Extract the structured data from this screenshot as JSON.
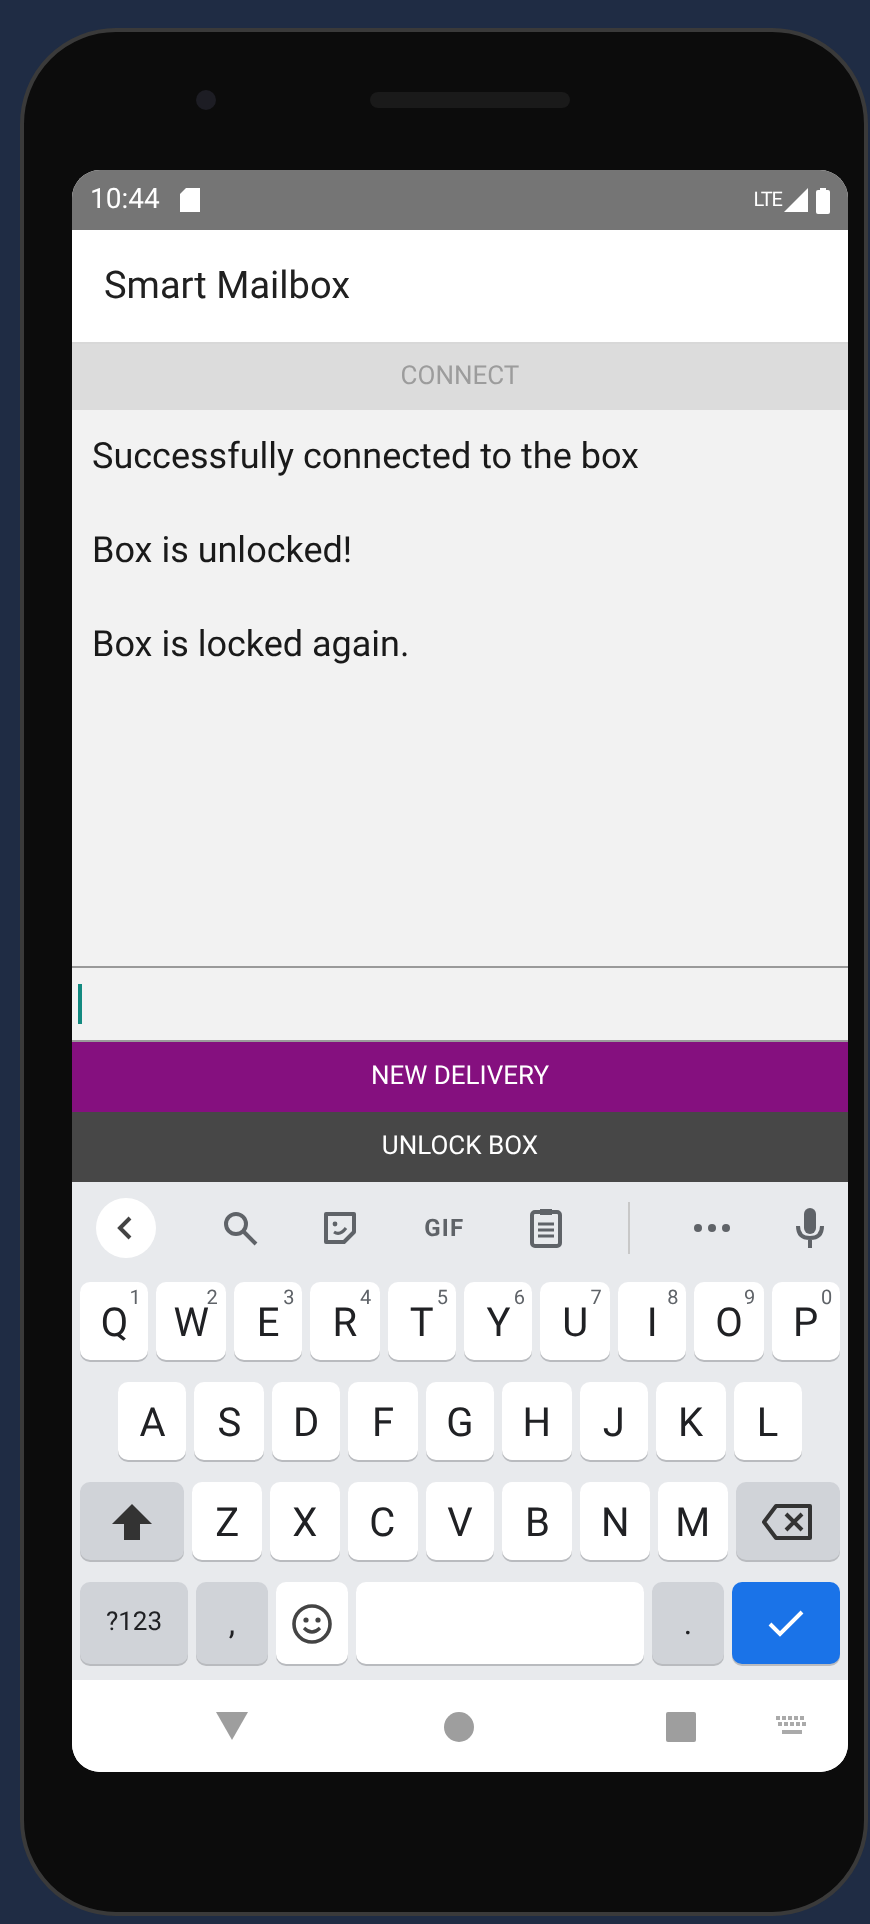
{
  "status_bar": {
    "time": "10:44",
    "network": "LTE"
  },
  "app_bar": {
    "title": "Smart Mailbox"
  },
  "connect_button": {
    "label": "CONNECT",
    "disabled": true
  },
  "messages": [
    "Successfully connected to the box",
    "Box is unlocked!",
    "Box is locked again."
  ],
  "input": {
    "focused": true
  },
  "buttons": [
    {
      "label": "NEW DELIVERY",
      "color": "#85107f"
    },
    {
      "label": "UNLOCK BOX",
      "color": "#474747"
    }
  ],
  "keyboard": {
    "toolbar": {
      "gif": "GIF"
    },
    "rows": [
      {
        "keys": [
          {
            "kind": "letter",
            "label": "Q",
            "hint": "1"
          },
          {
            "kind": "letter",
            "label": "W",
            "hint": "2"
          },
          {
            "kind": "letter",
            "label": "E",
            "hint": "3"
          },
          {
            "kind": "letter",
            "label": "R",
            "hint": "4"
          },
          {
            "kind": "letter",
            "label": "T",
            "hint": "5"
          },
          {
            "kind": "letter",
            "label": "Y",
            "hint": "6"
          },
          {
            "kind": "letter",
            "label": "U",
            "hint": "7"
          },
          {
            "kind": "letter",
            "label": "I",
            "hint": "8"
          },
          {
            "kind": "letter",
            "label": "O",
            "hint": "9"
          },
          {
            "kind": "letter",
            "label": "P",
            "hint": "0"
          }
        ]
      },
      {
        "keys": [
          {
            "kind": "letter",
            "label": "A"
          },
          {
            "kind": "letter",
            "label": "S"
          },
          {
            "kind": "letter",
            "label": "D"
          },
          {
            "kind": "letter",
            "label": "F"
          },
          {
            "kind": "letter",
            "label": "G"
          },
          {
            "kind": "letter",
            "label": "H"
          },
          {
            "kind": "letter",
            "label": "J"
          },
          {
            "kind": "letter",
            "label": "K"
          },
          {
            "kind": "letter",
            "label": "L"
          }
        ]
      },
      {
        "keys": [
          {
            "kind": "shift"
          },
          {
            "kind": "letter",
            "label": "Z"
          },
          {
            "kind": "letter",
            "label": "X"
          },
          {
            "kind": "letter",
            "label": "C"
          },
          {
            "kind": "letter",
            "label": "V"
          },
          {
            "kind": "letter",
            "label": "B"
          },
          {
            "kind": "letter",
            "label": "N"
          },
          {
            "kind": "letter",
            "label": "M"
          },
          {
            "kind": "backspace"
          }
        ]
      },
      {
        "keys": [
          {
            "kind": "symbols",
            "label": "?123"
          },
          {
            "kind": "punct",
            "label": ","
          },
          {
            "kind": "emoji"
          },
          {
            "kind": "space"
          },
          {
            "kind": "punct",
            "label": "."
          },
          {
            "kind": "enter"
          }
        ]
      }
    ]
  }
}
